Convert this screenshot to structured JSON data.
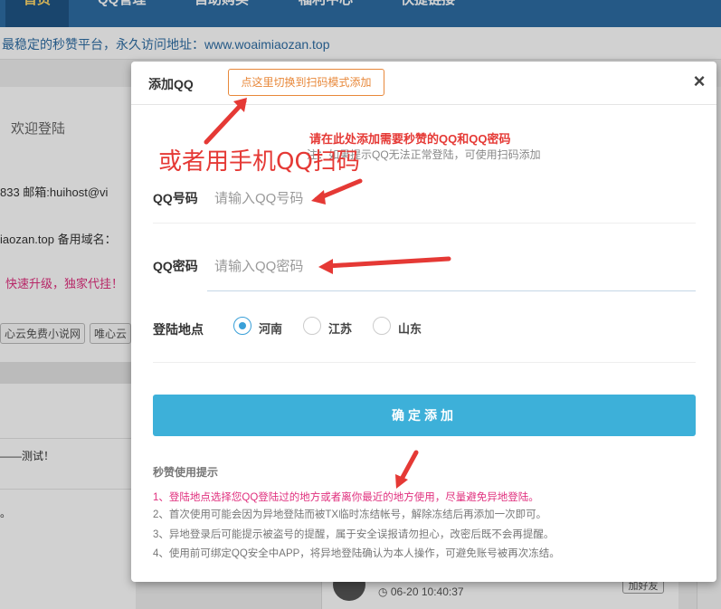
{
  "nav": {
    "items": [
      "首页",
      "QQ管理",
      "自助购买",
      "福利中心",
      "快捷链接"
    ]
  },
  "notice": "最稳定的秒赞平台，永久访问地址：www.woaimiaozan.top",
  "background": {
    "welcome": "欢迎登陆",
    "contact": "833 邮箱:huihost@vi",
    "domain": "iaozan.top  备用域名：",
    "promo": "快速升级，独家代挂！",
    "tags": [
      "心云免费小说网",
      "唯心云"
    ],
    "post": "——测试！",
    "dot": "。",
    "time": "06-20 10:40:37",
    "friend": "加好友"
  },
  "modal": {
    "title": "添加QQ",
    "switch_label": "点这里切换到扫码模式添加",
    "close": "×",
    "tip_red": "请在此处添加需要秒赞的QQ和QQ密码",
    "tip_gray": "注：如果提示QQ无法正常登陆，可使用扫码添加",
    "qq_label": "QQ号码",
    "qq_placeholder": "请输入QQ号码",
    "pwd_label": "QQ密码",
    "pwd_placeholder": "请输入QQ密码",
    "region_label": "登陆地点",
    "regions": [
      "河南",
      "江苏",
      "山东"
    ],
    "selected_region": "河南",
    "confirm": "确定添加",
    "hint_title": "秒赞使用提示",
    "hints": [
      "1、登陆地点选择您QQ登陆过的地方或者离你最近的地方使用，尽量避免异地登陆。",
      "2、首次使用可能会因为异地登陆而被TX临时冻结帐号，解除冻结后再添加一次即可。",
      "3、异地登录后可能提示被盗号的提醒，属于安全误报请勿担心，改密后既不会再提醒。",
      "4、使用前可绑定QQ安全中APP，将异地登陆确认为本人操作，可避免账号被再次冻结。"
    ]
  },
  "annotation": "或者用手机QQ扫码",
  "colors": {
    "accent": "#3db0d9",
    "warn": "#e8883a",
    "annot": "#e53935",
    "hint_highlight": "#e0307e"
  }
}
